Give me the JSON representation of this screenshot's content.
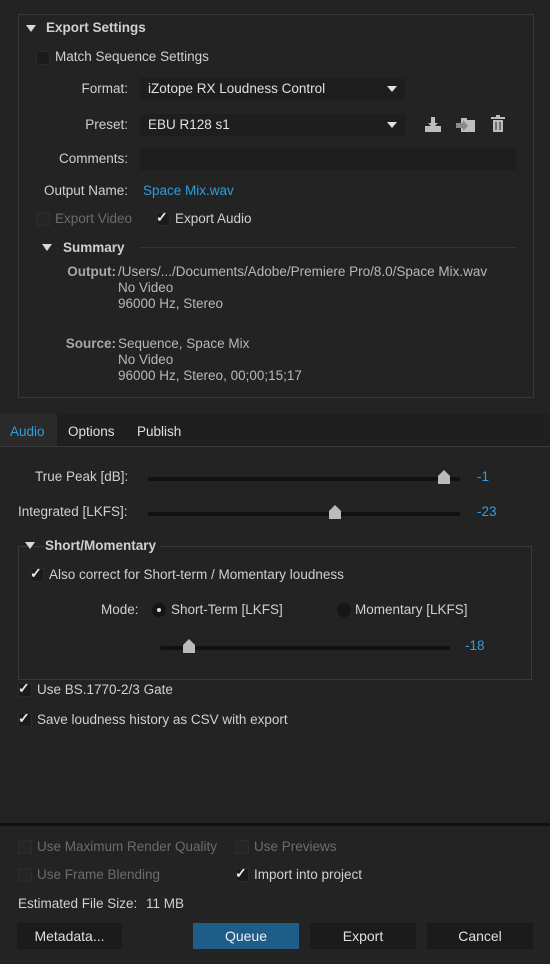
{
  "export_settings": {
    "title": "Export Settings",
    "match_sequence_label": "Match Sequence Settings",
    "format_label": "Format:",
    "format_value": "iZotope RX Loudness Control",
    "preset_label": "Preset:",
    "preset_value": "EBU R128 s1",
    "comments_label": "Comments:",
    "comments_value": "",
    "output_name_label": "Output Name:",
    "output_name_value": "Space Mix.wav",
    "export_video_label": "Export Video",
    "export_audio_label": "Export Audio",
    "summary": {
      "title": "Summary",
      "output_label": "Output:",
      "output_line1": "/Users/.../Documents/Adobe/Premiere Pro/8.0/Space Mix.wav",
      "output_line2": "No Video",
      "output_line3": "96000 Hz, Stereo",
      "source_label": "Source:",
      "source_line1": "Sequence, Space Mix",
      "source_line2": "No Video",
      "source_line3": "96000 Hz, Stereo, 00;00;15;17"
    }
  },
  "tabs": [
    "Audio",
    "Options",
    "Publish"
  ],
  "audio": {
    "true_peak_label": "True Peak [dB]:",
    "true_peak_value": "-1",
    "true_peak_level": 0.95,
    "integrated_label": "Integrated [LKFS]:",
    "integrated_value": "-23",
    "integrated_level": 0.6,
    "short_momentary": {
      "title": "Short/Momentary",
      "also_correct_label": "Also correct for Short-term / Momentary loudness",
      "mode_label": "Mode:",
      "short_term_label": "Short-Term [LKFS]",
      "momentary_label": "Momentary [LKFS]",
      "short_value": "-18",
      "short_level": 0.1
    },
    "gate_label": "Use BS.1770-2/3 Gate",
    "csv_label": "Save loudness history as CSV with export"
  },
  "bottom": {
    "max_render_label": "Use Maximum Render Quality",
    "use_previews_label": "Use Previews",
    "frame_blending_label": "Use Frame Blending",
    "import_label": "Import into project",
    "file_size_label": "Estimated File Size:",
    "file_size_value": "11 MB",
    "metadata_button": "Metadata...",
    "queue_button": "Queue",
    "export_button": "Export",
    "cancel_button": "Cancel"
  },
  "colors": {
    "accent": "#2e9ee0",
    "primary_button": "#1f5d89",
    "background": "#232323"
  },
  "icons": [
    "save-preset-icon",
    "import-preset-icon",
    "delete-preset-icon"
  ]
}
